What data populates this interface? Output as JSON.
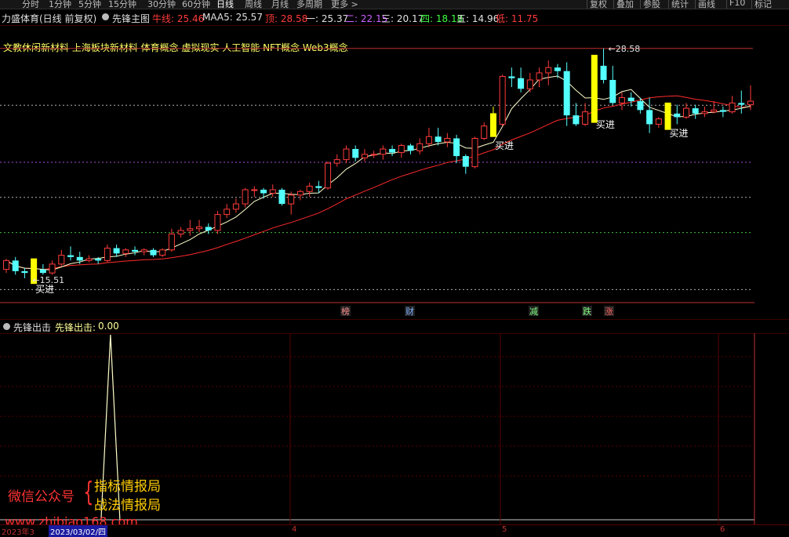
{
  "toolbar": {
    "periods": [
      "分时",
      "1分钟",
      "5分钟",
      "15分钟",
      "30分钟",
      "60分钟",
      "日线",
      "周线",
      "月线",
      "多周期",
      "更多 >"
    ],
    "active_period": "日线",
    "right_buttons": [
      "复权",
      "叠加",
      "参股",
      "统计",
      "画线",
      "F10",
      "标记"
    ]
  },
  "infobar": {
    "stock_title": "力盛体育(日线 前复权)",
    "indicator_name": "先锋主图",
    "items": [
      {
        "label": "牛线:",
        "value": "25.46",
        "color": "#ff3b3b"
      },
      {
        "label": "MAA5:",
        "value": "25.57",
        "color": "#e0e0e0"
      },
      {
        "label": "顶:",
        "value": "28.58",
        "color": "#ff3b3b"
      },
      {
        "label": "一:",
        "value": "25.37",
        "color": "#e0e0e0"
      },
      {
        "label": "二:",
        "value": "22.15",
        "color": "#d060ff"
      },
      {
        "label": "三:",
        "value": "20.17",
        "color": "#e0e0e0"
      },
      {
        "label": "四:",
        "value": "18.18",
        "color": "#40ff40"
      },
      {
        "label": "五:",
        "value": "14.96",
        "color": "#e0e0e0"
      },
      {
        "label": "低:",
        "value": "11.75",
        "color": "#ff3b3b"
      }
    ]
  },
  "concepts": "文教休闲新材料 上海板块新材料 体育概念 虚拟现实 人工智能 NFT概念 Web3概念",
  "main_chart": {
    "high_label": "28.58",
    "low_label": "15.51",
    "buy_label": "买进",
    "events": [
      "榜",
      "财",
      "减",
      "跌",
      "涨"
    ],
    "candles": [
      [
        16.1,
        16.7,
        15.9,
        16.6
      ],
      [
        16.6,
        16.8,
        15.8,
        16.0
      ],
      [
        16.0,
        16.2,
        15.6,
        15.9
      ],
      [
        15.9,
        16.2,
        15.6,
        16.1
      ],
      [
        16.1,
        16.4,
        15.8,
        15.9
      ],
      [
        15.9,
        16.6,
        15.8,
        16.4
      ],
      [
        16.4,
        17.2,
        16.3,
        16.9
      ],
      [
        16.9,
        17.4,
        16.6,
        16.8
      ],
      [
        16.8,
        17.1,
        16.4,
        16.6
      ],
      [
        16.6,
        16.9,
        16.5,
        16.7
      ],
      [
        16.7,
        16.8,
        16.4,
        16.6
      ],
      [
        16.6,
        17.5,
        16.5,
        17.3
      ],
      [
        17.3,
        17.5,
        16.8,
        17.0
      ],
      [
        17.0,
        17.3,
        16.8,
        17.2
      ],
      [
        17.2,
        17.4,
        16.9,
        17.1
      ],
      [
        17.1,
        17.3,
        16.9,
        17.2
      ],
      [
        17.2,
        17.3,
        16.8,
        16.9
      ],
      [
        16.9,
        17.3,
        16.8,
        17.2
      ],
      [
        17.2,
        18.4,
        17.1,
        18.1
      ],
      [
        18.1,
        18.5,
        17.9,
        18.3
      ],
      [
        18.3,
        18.9,
        18.0,
        18.4
      ],
      [
        18.4,
        18.9,
        18.2,
        18.5
      ],
      [
        18.5,
        18.7,
        18.1,
        18.3
      ],
      [
        18.3,
        19.4,
        18.1,
        19.2
      ],
      [
        19.2,
        19.8,
        19.0,
        19.5
      ],
      [
        19.5,
        20.1,
        19.3,
        19.8
      ],
      [
        19.8,
        20.7,
        19.6,
        20.6
      ],
      [
        20.6,
        20.8,
        20.2,
        20.6
      ],
      [
        20.6,
        20.7,
        20.1,
        20.4
      ],
      [
        20.4,
        20.9,
        20.2,
        20.6
      ],
      [
        20.6,
        20.7,
        19.7,
        19.8
      ],
      [
        19.8,
        20.5,
        19.2,
        20.3
      ],
      [
        20.3,
        20.6,
        20.0,
        20.5
      ],
      [
        20.5,
        21.0,
        20.2,
        20.8
      ],
      [
        20.8,
        21.1,
        20.4,
        20.7
      ],
      [
        20.7,
        22.2,
        20.6,
        22.1
      ],
      [
        22.1,
        22.6,
        21.9,
        22.3
      ],
      [
        22.3,
        23.1,
        22.1,
        22.9
      ],
      [
        22.9,
        23.1,
        22.2,
        22.4
      ],
      [
        22.4,
        22.9,
        22.2,
        22.6
      ],
      [
        22.6,
        22.8,
        22.4,
        22.6
      ],
      [
        22.6,
        23.1,
        22.3,
        22.9
      ],
      [
        22.9,
        23.1,
        22.5,
        22.7
      ],
      [
        22.7,
        23.2,
        22.4,
        23.1
      ],
      [
        23.1,
        23.2,
        22.6,
        22.8
      ],
      [
        22.8,
        23.5,
        22.6,
        23.2
      ],
      [
        23.2,
        24.1,
        23.0,
        23.6
      ],
      [
        23.6,
        24.1,
        23.1,
        23.3
      ],
      [
        23.3,
        23.8,
        23.0,
        23.5
      ],
      [
        23.5,
        23.7,
        22.1,
        22.5
      ],
      [
        22.5,
        22.6,
        21.5,
        21.9
      ],
      [
        21.9,
        23.6,
        21.8,
        23.5
      ],
      [
        23.5,
        24.4,
        23.4,
        24.2
      ],
      [
        24.2,
        25.3,
        23.7,
        24.3
      ],
      [
        24.3,
        27.1,
        24.2,
        27.0
      ],
      [
        27.0,
        27.5,
        26.4,
        26.9
      ],
      [
        26.9,
        27.5,
        26.1,
        26.3
      ],
      [
        26.3,
        27.2,
        26.1,
        26.8
      ],
      [
        26.8,
        27.5,
        26.4,
        27.2
      ],
      [
        27.2,
        27.9,
        26.5,
        27.5
      ],
      [
        27.5,
        27.7,
        26.9,
        27.3
      ],
      [
        27.3,
        27.8,
        24.2,
        24.8
      ],
      [
        24.8,
        25.5,
        24.2,
        24.3
      ],
      [
        24.3,
        25.5,
        24.2,
        25.0
      ],
      [
        25.0,
        28.0,
        24.9,
        27.6
      ],
      [
        27.6,
        28.58,
        26.6,
        26.8
      ],
      [
        26.8,
        27.6,
        25.4,
        25.5
      ],
      [
        25.5,
        26.1,
        25.1,
        25.8
      ],
      [
        25.8,
        26.1,
        25.3,
        25.6
      ],
      [
        25.6,
        25.8,
        24.9,
        25.1
      ],
      [
        25.1,
        25.8,
        23.8,
        24.3
      ],
      [
        24.3,
        24.7,
        24.1,
        24.6
      ],
      [
        24.6,
        25.2,
        24.4,
        24.9
      ],
      [
        24.9,
        25.4,
        24.3,
        24.7
      ],
      [
        24.7,
        25.5,
        24.6,
        25.2
      ],
      [
        25.2,
        25.4,
        24.6,
        24.9
      ],
      [
        24.9,
        25.3,
        24.7,
        25.0
      ],
      [
        25.0,
        25.6,
        24.9,
        25.1
      ],
      [
        25.1,
        25.3,
        24.7,
        25.0
      ],
      [
        25.0,
        25.9,
        24.9,
        25.5
      ],
      [
        25.5,
        26.2,
        24.9,
        25.4
      ],
      [
        25.4,
        26.5,
        25.1,
        25.6
      ]
    ],
    "buy_bars": [
      3,
      53,
      64,
      72
    ],
    "buy_label_bars": [
      3,
      53,
      64,
      72
    ]
  },
  "sub_chart": {
    "title": "先锋出击",
    "value_label": "先锋出击:",
    "value": "0.00",
    "spike_bar": 11
  },
  "watermark": {
    "wechat": "微信公众号",
    "line1": "指标情报局",
    "line2": "战法情报局",
    "url": "www.zhibiao168.com"
  },
  "dates": {
    "year": "2023年3",
    "cursor": "2023/03/02/四",
    "months": [
      "4",
      "5",
      "6"
    ]
  },
  "colors": {
    "up": "#ff3b3b",
    "down": "#54ffff",
    "buy": "#ffff00",
    "ma_white": "#ffffcc",
    "ma_red": "#ff2a2a"
  }
}
